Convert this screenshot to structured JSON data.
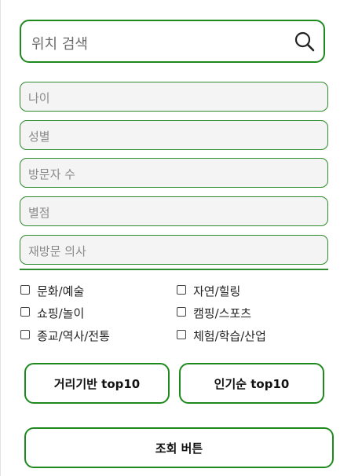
{
  "search": {
    "placeholder": "위치 검색",
    "icon": "search-icon"
  },
  "fields": [
    {
      "placeholder": "나이"
    },
    {
      "placeholder": "성별"
    },
    {
      "placeholder": "방문자 수"
    },
    {
      "placeholder": "별점"
    },
    {
      "placeholder": "재방문 의사"
    }
  ],
  "categories": [
    {
      "label": "문화/예술",
      "checked": false
    },
    {
      "label": "자연/힐링",
      "checked": false
    },
    {
      "label": "쇼핑/놀이",
      "checked": false
    },
    {
      "label": "캠핑/스포츠",
      "checked": false
    },
    {
      "label": "종교/역사/전통",
      "checked": false
    },
    {
      "label": "체험/학습/산업",
      "checked": false
    }
  ],
  "buttons": {
    "distance_top10": "거리기반 top10",
    "popular_top10": "인기순 top10",
    "query": "조회 버튼"
  },
  "colors": {
    "accent": "#1e8a1e",
    "field_bg": "#f4f4f4"
  }
}
